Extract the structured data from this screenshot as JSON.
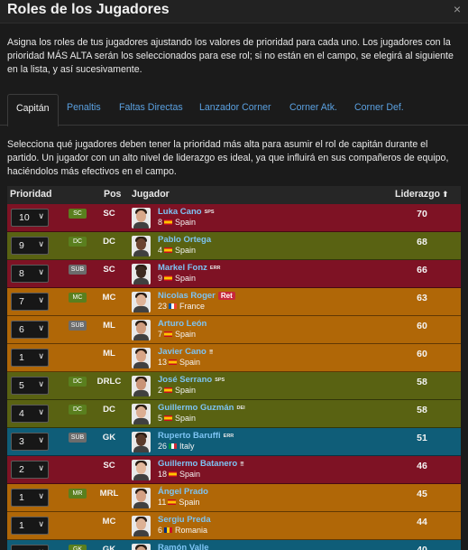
{
  "window": {
    "title": "Roles de los Jugadores",
    "close_glyph": "×"
  },
  "intro": "Asigna los roles de tus jugadores ajustando los valores de prioridad para cada uno. Los jugadores con la prioridad MÁS ALTA serán los seleccionados para ese rol; si no están en el campo, se elegirá al siguiente en la lista, y así sucesivamente.",
  "tabs": [
    "Capitán",
    "Penaltis",
    "Faltas Directas",
    "Lanzador Corner",
    "Corner Atk.",
    "Corner Def."
  ],
  "active_tab": "Capitán",
  "description": "Selecciona qué jugadores deben tener la prioridad más alta para asumir el rol de capitán durante el partido. Un jugador con un alto nivel de liderazgo es ideal, ya que influirá en sus compañeros de equipo, haciéndolos más efectivos en el campo.",
  "table": {
    "headers": {
      "priority": "Prioridad",
      "pos": "Pos",
      "player": "Jugador",
      "leadership": "Liderazgo",
      "sort_icon": "⬆"
    },
    "colors": {
      "red": "#7e1224",
      "olive": "#596212",
      "orange": "#b06707",
      "teal": "#0f5d78",
      "link": "#7dc4f4",
      "badge_green": "#5a7f1e",
      "badge_gray": "#6c6c6c"
    },
    "rows": [
      {
        "priority": "10",
        "badge": "SC",
        "pos": "SC",
        "name": "Luka Cano",
        "tag": "SPS",
        "number": "8",
        "country": "Spain",
        "flag": "es",
        "leadership": "70",
        "color": "red"
      },
      {
        "priority": "9",
        "badge": "DC",
        "pos": "DC",
        "name": "Pablo Ortega",
        "tag": "",
        "number": "4",
        "country": "Spain",
        "flag": "es",
        "leadership": "68",
        "color": "olive"
      },
      {
        "priority": "8",
        "badge": "SUB",
        "pos": "SC",
        "name": "Markel Fonz",
        "tag": "ERR",
        "number": "9",
        "country": "Spain",
        "flag": "es",
        "leadership": "66",
        "color": "red"
      },
      {
        "priority": "7",
        "badge": "MC",
        "pos": "MC",
        "name": "Nicolas Roger",
        "tag": "",
        "ret": "Ret",
        "number": "23",
        "country": "France",
        "flag": "fr",
        "leadership": "63",
        "color": "orange"
      },
      {
        "priority": "6",
        "badge": "SUB",
        "pos": "ML",
        "name": "Arturo León",
        "tag": "",
        "number": "7",
        "country": "Spain",
        "flag": "es",
        "leadership": "60",
        "color": "orange"
      },
      {
        "priority": "1",
        "badge": "",
        "pos": "ML",
        "name": "Javier Cano",
        "tag": "≣",
        "number": "13",
        "country": "Spain",
        "flag": "es",
        "leadership": "60",
        "color": "orange"
      },
      {
        "priority": "5",
        "badge": "DC",
        "pos": "DRLC",
        "name": "José Serrano",
        "tag": "SPS",
        "number": "2",
        "country": "Spain",
        "flag": "es",
        "leadership": "58",
        "color": "olive"
      },
      {
        "priority": "4",
        "badge": "DC",
        "pos": "DC",
        "name": "Guillermo Guzmán",
        "tag": "DEI",
        "number": "5",
        "country": "Spain",
        "flag": "es",
        "leadership": "58",
        "color": "olive"
      },
      {
        "priority": "3",
        "badge": "SUB",
        "pos": "GK",
        "name": "Ruperto Baruffi",
        "tag": "ERR",
        "number": "26",
        "country": "Italy",
        "flag": "it",
        "leadership": "51",
        "color": "teal"
      },
      {
        "priority": "2",
        "badge": "",
        "pos": "SC",
        "name": "Guillermo Batanero",
        "tag": "≣",
        "number": "18",
        "country": "Spain",
        "flag": "es",
        "leadership": "46",
        "color": "red"
      },
      {
        "priority": "1",
        "badge": "MR",
        "pos": "MRL",
        "name": "Ángel Prado",
        "tag": "",
        "number": "11",
        "country": "Spain",
        "flag": "es",
        "leadership": "45",
        "color": "orange"
      },
      {
        "priority": "1",
        "badge": "",
        "pos": "MC",
        "name": "Sergiu Preda",
        "tag": "",
        "number": "6",
        "country": "Romania",
        "flag": "ro",
        "leadership": "44",
        "color": "orange"
      },
      {
        "priority": "",
        "badge": "GK",
        "pos": "GK",
        "name": "Ramón Valle",
        "tag": "",
        "number": "",
        "country": "",
        "flag": "es",
        "leadership": "40",
        "color": "teal"
      }
    ]
  }
}
